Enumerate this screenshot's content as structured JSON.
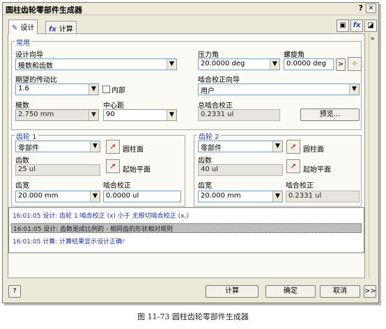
{
  "window": {
    "title": "圆柱齿轮零部件生成器",
    "help_label": "?",
    "close_label": "×"
  },
  "tabs": [
    {
      "icon": "✎",
      "label": "设计"
    },
    {
      "icon": "fx",
      "label": "计算"
    }
  ],
  "toolbar": {
    "buttons": [
      "▣",
      "fx",
      "◪"
    ]
  },
  "common": {
    "group_label": "常用",
    "design_guide_label": "设计向导",
    "design_guide_value": "模数和齿数",
    "ratio_label": "期望的传动比",
    "ratio_value": "1.6",
    "internal_label": "内部",
    "module_label": "模数",
    "module_value": "2.750 mm",
    "center_label": "中心距",
    "center_value": "90",
    "pressure_label": "压力角",
    "pressure_value": "20.0000 deg",
    "helix_label": "螺旋角",
    "helix_value": "0.0000 deg",
    "helix_btn": ">",
    "correction_guide_label": "啮合校正向导",
    "correction_guide_value": "用户",
    "total_corr_label": "总啮合校正",
    "total_corr_value": "0.2331 ul",
    "preview_label": "预览..."
  },
  "gear1": {
    "group_label": "齿轮 1",
    "type_value": "零部件",
    "cylinder_label": "圆柱面",
    "plane_label": "起始平面",
    "teeth_label": "齿数",
    "teeth_value": "25 ul",
    "width_label": "齿宽",
    "width_value": "20.000 mm",
    "corr_label": "啮合校正",
    "corr_value": "0.0000 ul"
  },
  "gear2": {
    "group_label": "齿轮 2",
    "type_value": "零部件",
    "cylinder_label": "圆柱面",
    "plane_label": "起始平面",
    "teeth_label": "齿数",
    "teeth_value": "40 ul",
    "width_label": "齿宽",
    "width_value": "20.000 mm",
    "corr_label": "啮合校正",
    "corr_value": "0.2331 ul"
  },
  "log": [
    "16:01:05 设计: 齿轮 1:啮合校正 (x) 小于 无根切啮合校正 (x꜀)",
    "16:01:05 设计: 齿数是成比例的 - 相同齿的形状相对规则",
    "16:01:05 计算: 计算结果显示设计正确!"
  ],
  "footer": {
    "help_icon": "?",
    "calc_label": "计算",
    "ok_label": "确定",
    "cancel_label": "取消",
    "more_label": ">>"
  },
  "caption": "图 11-73  圆柱齿轮零部件生成器"
}
